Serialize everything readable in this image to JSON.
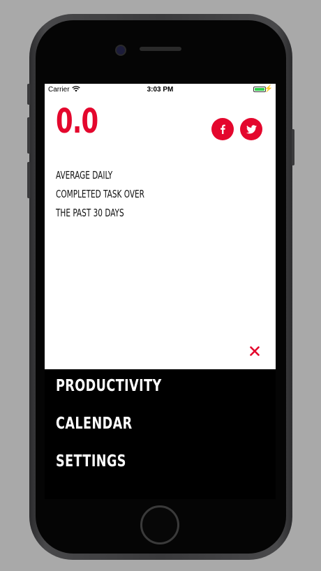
{
  "status_bar": {
    "carrier": "Carrier",
    "time": "3:03 PM",
    "battery_level": 1.0,
    "battery_color": "#2fd04b"
  },
  "stat": {
    "value": "0.0",
    "description_lines": [
      "AVERAGE DAILY",
      "COMPLETED TASK OVER",
      "THE PAST 30 DAYS"
    ]
  },
  "share": {
    "facebook_icon": "facebook-icon",
    "twitter_icon": "twitter-icon"
  },
  "close_icon": "close-icon",
  "menu": {
    "items": [
      {
        "label": "PRODUCTIVITY"
      },
      {
        "label": "CALENDAR"
      },
      {
        "label": "SETTINGS"
      }
    ]
  },
  "colors": {
    "accent": "#e4072d",
    "card_bg": "#ffffff",
    "menu_bg": "#000000",
    "menu_text": "#ffffff"
  }
}
